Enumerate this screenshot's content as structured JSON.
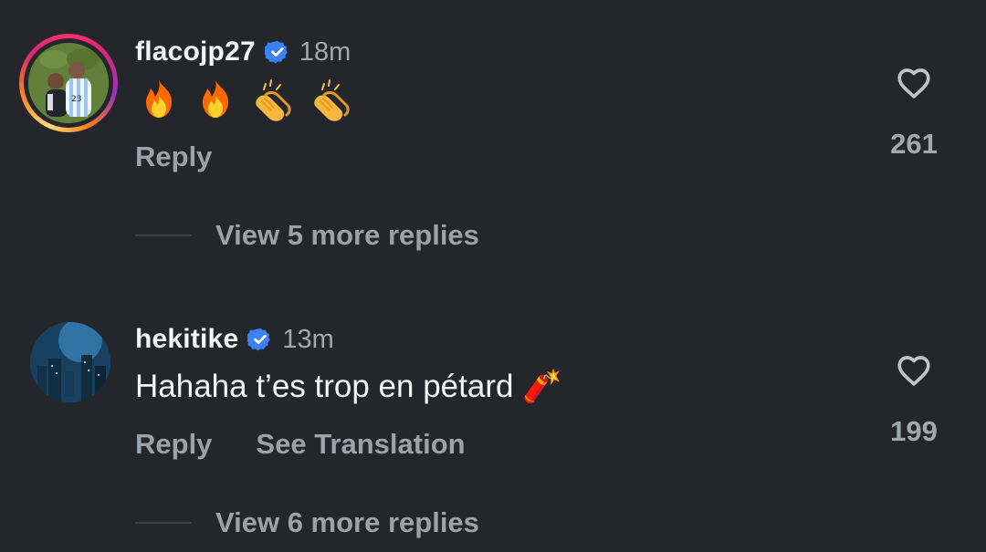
{
  "comments": [
    {
      "username": "flacojp27",
      "time": "18m",
      "text": "🔥🔥👏👏",
      "reply_label": "Reply",
      "likes": "261"
    },
    {
      "username": "hekitike",
      "time": "13m",
      "text": "Hahaha t’es trop en pétard 🧨",
      "reply_label": "Reply",
      "translate_label": "See Translation",
      "likes": "199"
    }
  ],
  "view_replies": [
    "View 5 more replies",
    "View 6 more replies"
  ],
  "icons": {
    "verified": "verified-badge-icon",
    "heart": "heart-outline-icon",
    "fire": "fire-emoji",
    "clap": "clapping-hands-emoji",
    "firecracker": "firecracker-emoji"
  },
  "colors": {
    "background": "#24262b",
    "verified": "#3b82f6",
    "muted_text": "#9ca1aa"
  }
}
